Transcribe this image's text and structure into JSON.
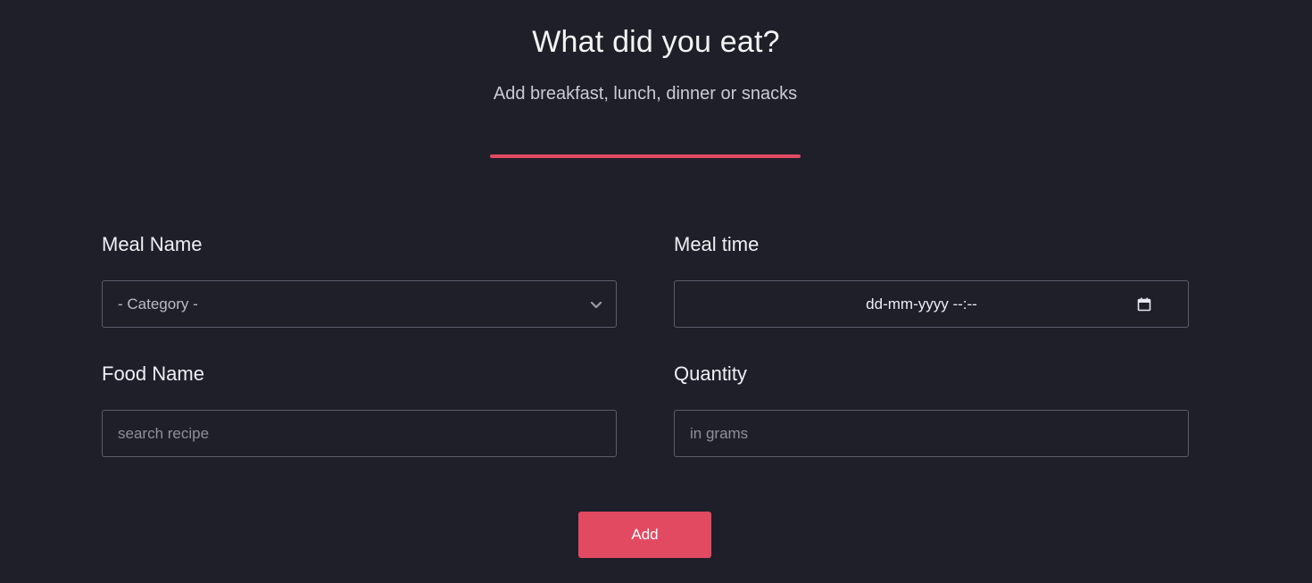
{
  "header": {
    "title": "What did you eat?",
    "subtitle": "Add breakfast, lunch, dinner or snacks"
  },
  "form": {
    "meal_name": {
      "label": "Meal Name",
      "selected": "- Category -"
    },
    "meal_time": {
      "label": "Meal time",
      "value": "dd-mm-yyyy --:--"
    },
    "food_name": {
      "label": "Food Name",
      "placeholder": "search recipe"
    },
    "quantity": {
      "label": "Quantity",
      "placeholder": "in grams"
    },
    "submit_label": "Add"
  },
  "icons": {
    "dropdown": "chevron-down-icon",
    "date_picker": "calendar-icon"
  },
  "colors": {
    "background": "#1f1f29",
    "accent": "#e24a62",
    "border": "#5a5d6b"
  }
}
